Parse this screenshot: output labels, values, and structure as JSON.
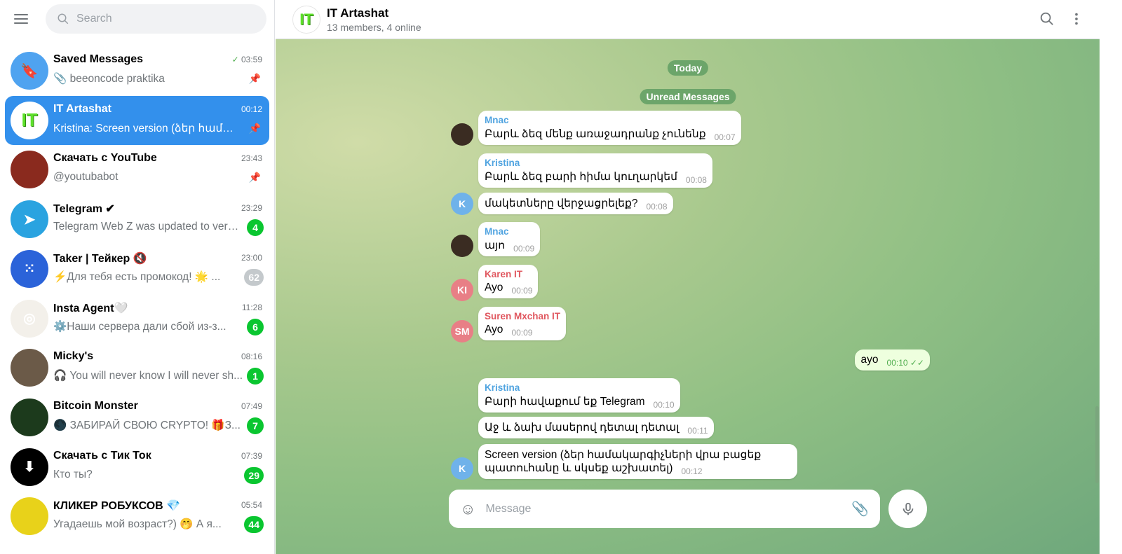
{
  "sidebar": {
    "search_placeholder": "Search",
    "chats": [
      {
        "name": "Saved Messages",
        "time": "03:59",
        "preview": "📎 beeoncode praktika",
        "pinned": true,
        "read": true,
        "avatar_color": "#4fa3f0",
        "avatar_text": "🔖"
      },
      {
        "name": "IT Artashat",
        "time": "00:12",
        "preview": "Kristina: Screen version (ձեր համակ...",
        "pinned": true,
        "active": true,
        "avatar_text": "IT"
      },
      {
        "name": "Скачать с YouTube",
        "time": "23:43",
        "preview": "@youtubabot",
        "pinned": true,
        "avatar_color": "#8a2a1e",
        "avatar_text": ""
      },
      {
        "name": "Telegram ✔",
        "time": "23:29",
        "preview": "Telegram Web Z was updated to versi...",
        "badge": "4",
        "avatar_color": "#2aa3e0",
        "avatar_text": "➤"
      },
      {
        "name": "Taker | Тейкер 🔇",
        "time": "23:00",
        "preview": "⚡Для тебя есть промокод! 🌟 ...",
        "badge": "62",
        "muted": true,
        "avatar_color": "#2b63d9",
        "avatar_text": "⁙"
      },
      {
        "name": "Insta Agent🤍",
        "time": "11:28",
        "preview": "⚙️Наши сервера дали сбой из-з...",
        "badge": "6",
        "avatar_color": "#f3f0ea",
        "avatar_text": "◎"
      },
      {
        "name": "Micky's",
        "time": "08:16",
        "preview": "🎧 You will never know I will never sh...",
        "badge": "1",
        "avatar_color": "#6b5a48",
        "avatar_text": ""
      },
      {
        "name": "Bitcoin Monster",
        "time": "07:49",
        "preview": "🌑 ЗАБИРАЙ СВОЮ CRYPTO! 🎁З...",
        "badge": "7",
        "avatar_color": "#1c3a1c",
        "avatar_text": ""
      },
      {
        "name": "Скачать с Тик Ток",
        "time": "07:39",
        "preview": "Кто ты?",
        "badge": "29",
        "avatar_color": "#000000",
        "avatar_text": "⬇"
      },
      {
        "name": "КЛИКЕР РОБУКСОВ 💎",
        "time": "05:54",
        "preview": "Угадаешь мой возраст?) 🤭 А я...",
        "badge": "44",
        "avatar_color": "#e8d21a",
        "avatar_text": ""
      }
    ]
  },
  "header": {
    "title": "IT Artashat",
    "subtitle": "13 members, 4 online"
  },
  "chat": {
    "date_label": "Today",
    "unread_label": "Unread Messages",
    "messages": [
      {
        "sender": "Mnac",
        "text": "Բարև ձեզ մենք առաջադրանք չունենք",
        "time": "00:07",
        "sender_color": "#4fa3e0"
      },
      {
        "sender": "Kristina",
        "text": "Բարև ձեզ բարի հիմա կուղարկեմ",
        "time": "00:08",
        "sender_color": "#4fa3e0"
      },
      {
        "text": "մակետները վերջացրելեք?",
        "time": "00:08"
      },
      {
        "sender": "Mnac",
        "text": "այո",
        "time": "00:09",
        "sender_color": "#4fa3e0"
      },
      {
        "sender": "Karen IT",
        "text": "Ayo",
        "time": "00:09",
        "sender_color": "#e0575f"
      },
      {
        "sender": "Suren Mxchan IT",
        "text": "Ayo",
        "time": "00:09",
        "sender_color": "#e0575f"
      },
      {
        "text": "ayo",
        "time": "00:10 ✓✓",
        "outgoing": true
      },
      {
        "sender": "Kristina",
        "text": "Բարի հավաքում եք Telegram",
        "time": "00:10",
        "sender_color": "#4fa3e0"
      },
      {
        "text": "Աջ և ձախ մասերով դետալ դետալ",
        "time": "00:11"
      },
      {
        "text": "Screen version (ձեր համակարգիչների վրա բացեք պատուհանը և սկսեք աշխատել)",
        "time": "00:12"
      }
    ],
    "avatars": [
      {
        "initials": "K",
        "color": "#6fb2ea"
      },
      {
        "initials": "KI",
        "color": "#e87f86"
      },
      {
        "initials": "SM",
        "color": "#e87f86"
      }
    ]
  },
  "composer": {
    "placeholder": "Message"
  }
}
